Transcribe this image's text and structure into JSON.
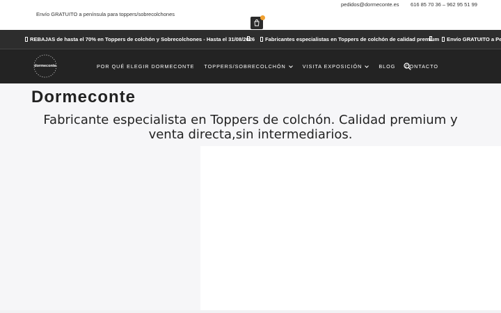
{
  "topbar": {
    "shipping_text": "Envío GRATUITO a península para toppers/sobrecolchones",
    "email": "pedidos@dormeconte.es",
    "phones": "616 85 70 36 – 962 95 51 99"
  },
  "cart": {
    "icon": "shopping-bag-icon",
    "badge_color": "#f0a030"
  },
  "ticker": {
    "items": [
      "REBAJAS de hasta el 70% en Toppers de colchón y Sobrecolchones - Hasta el 31/08/2026",
      "Fabricantes especialistas en Toppers de colchón de calidad premium",
      "Envío GRATUITO a Per"
    ]
  },
  "logo": {
    "text": "dormeconte"
  },
  "nav": {
    "items": [
      {
        "label": "POR QUÉ ELEGIR DORMECONTE",
        "dropdown": false
      },
      {
        "label": "TOPPERS/SOBRECOLCHÓN",
        "dropdown": true
      },
      {
        "label": "VISITA EXPOSICIÓN",
        "dropdown": true
      },
      {
        "label": "BLOG",
        "dropdown": false
      },
      {
        "label": "CONTACTO",
        "dropdown": false
      }
    ],
    "search_icon": "search-icon"
  },
  "hero": {
    "title": "Dormeconte",
    "tagline": "Fabricante especialista en Toppers de colchón. Calidad premium y venta directa,sin intermediarios."
  },
  "colors": {
    "nav_bg": "#232323",
    "ticker_bg": "#2d2d2d",
    "hero_bg": "#f6f6f8",
    "accent": "#f0a030"
  }
}
